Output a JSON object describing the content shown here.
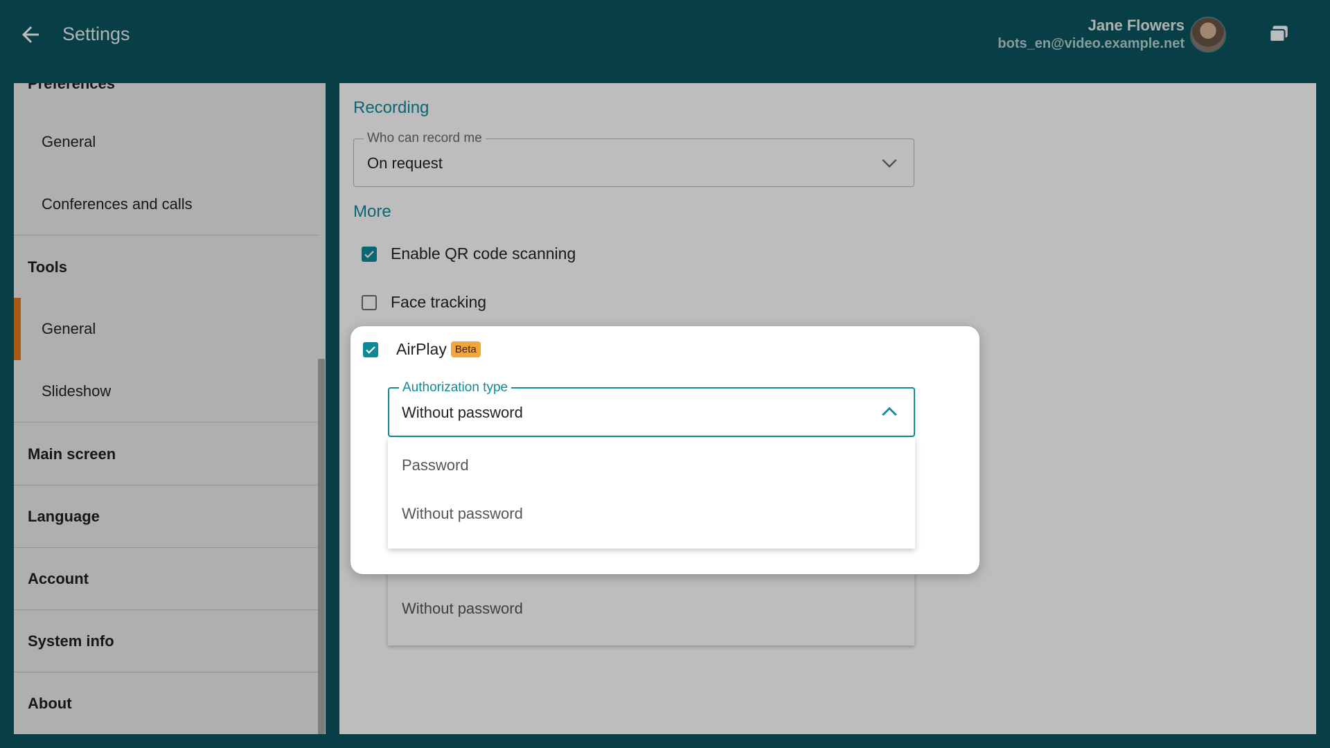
{
  "header": {
    "title": "Settings",
    "user_name": "Jane Flowers",
    "user_email": "bots_en@video.example.net"
  },
  "sidebar": {
    "partial_section": "Preferences",
    "preferences_items": [
      "General",
      "Conferences and calls"
    ],
    "tools_label": "Tools",
    "tools_items": [
      "General",
      "Slideshow"
    ],
    "active_item": "Tools / General",
    "sections": [
      "Main screen",
      "Language",
      "Account",
      "System info",
      "About"
    ]
  },
  "main": {
    "recording": {
      "heading": "Recording",
      "who_can_record_label": "Who can record me",
      "who_can_record_value": "On request"
    },
    "more": {
      "heading": "More",
      "qr_label": "Enable QR code scanning",
      "qr_checked": true,
      "face_label": "Face tracking",
      "face_checked": false
    },
    "ghost_option": "Without password"
  },
  "popup": {
    "airplay_label": "AirPlay",
    "airplay_checked": true,
    "beta_badge": "Beta",
    "auth_label": "Authorization type",
    "auth_value": "Without password",
    "options": [
      "Password",
      "Without password"
    ]
  },
  "colors": {
    "header_bg": "#0b5560",
    "accent": "#0e8a97",
    "active_marker": "#e07a1c",
    "beta_badge": "#f5a43a"
  }
}
